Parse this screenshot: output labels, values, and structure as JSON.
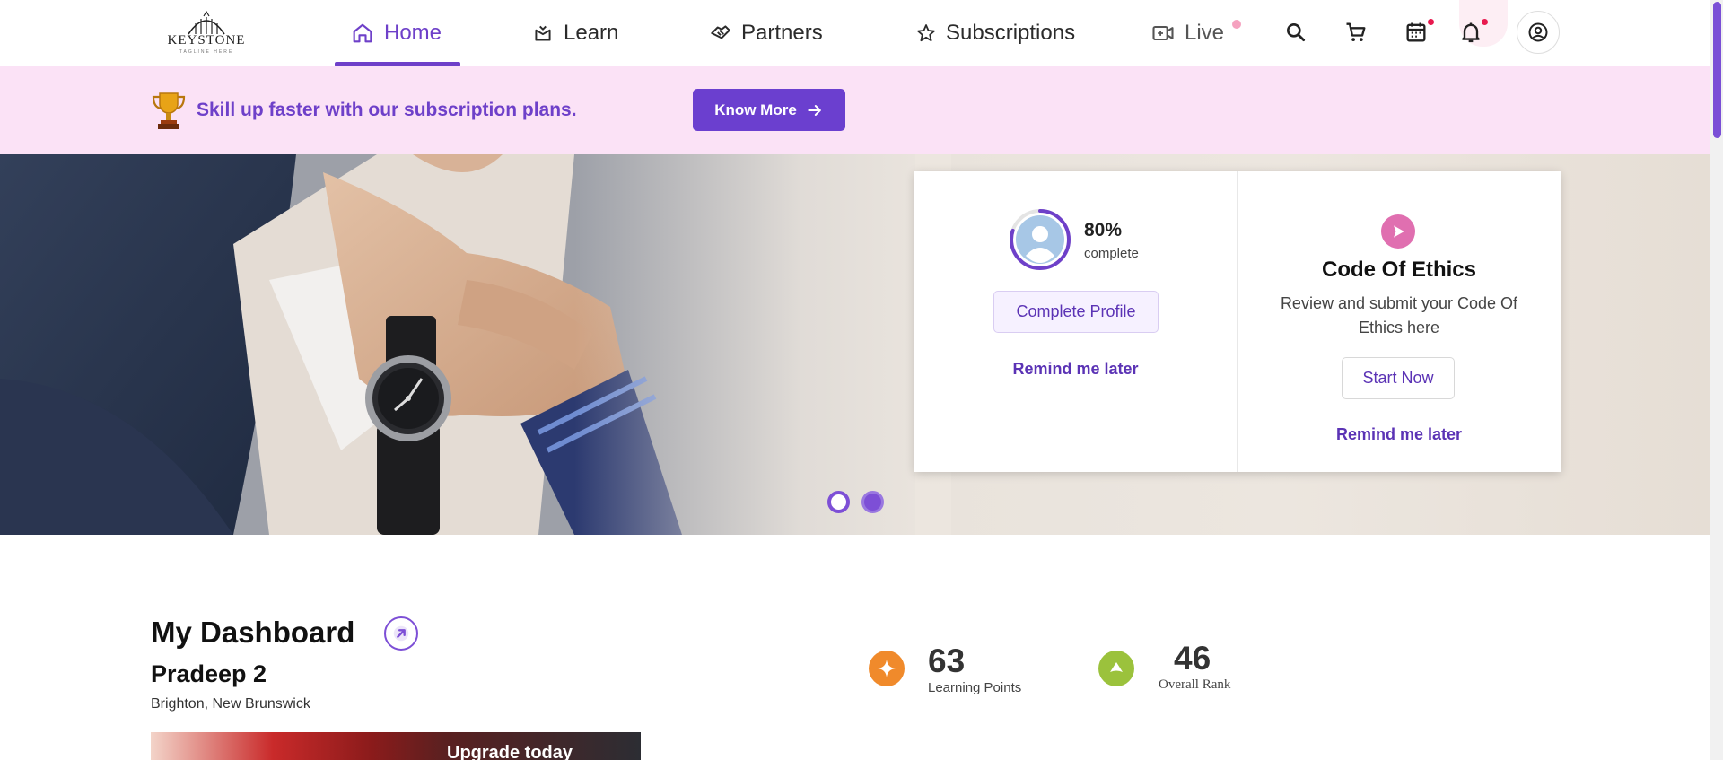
{
  "brand": {
    "name": "KEYSTONE",
    "tagline": "TAGLINE HERE"
  },
  "nav": {
    "items": [
      {
        "label": "Home",
        "icon": "home-icon",
        "active": true
      },
      {
        "label": "Learn",
        "icon": "learn-icon",
        "active": false
      },
      {
        "label": "Partners",
        "icon": "handshake-icon",
        "active": false
      },
      {
        "label": "Subscriptions",
        "icon": "star-icon",
        "active": false
      },
      {
        "label": "Live",
        "icon": "video-icon",
        "active": false
      }
    ],
    "icons": [
      "search-icon",
      "cart-icon",
      "calendar-icon",
      "bell-icon",
      "profile-icon"
    ]
  },
  "promo": {
    "text": "Skill up faster with our subscription plans.",
    "button": "Know More"
  },
  "profile_card": {
    "percent": "80%",
    "percent_label": "complete",
    "progress": 0.8,
    "button": "Complete Profile",
    "remind": "Remind me later"
  },
  "ethics_card": {
    "title": "Code Of Ethics",
    "description": "Review and submit your Code Of Ethics here",
    "button": "Start Now",
    "remind": "Remind me later"
  },
  "carousel": {
    "count": 2,
    "active": 0
  },
  "dashboard": {
    "title": "My Dashboard",
    "user_name": "Pradeep 2",
    "location": "Brighton, New Brunswick",
    "banner_text": "Upgrade today"
  },
  "stats": {
    "learning_points": {
      "value": "63",
      "label": "Learning Points"
    },
    "overall_rank": {
      "value": "46",
      "label": "Overall Rank"
    }
  },
  "colors": {
    "accent": "#6e40c9",
    "promo_bg": "#fbe2f6",
    "points": "#f08a2b",
    "rank": "#9bc23c"
  }
}
